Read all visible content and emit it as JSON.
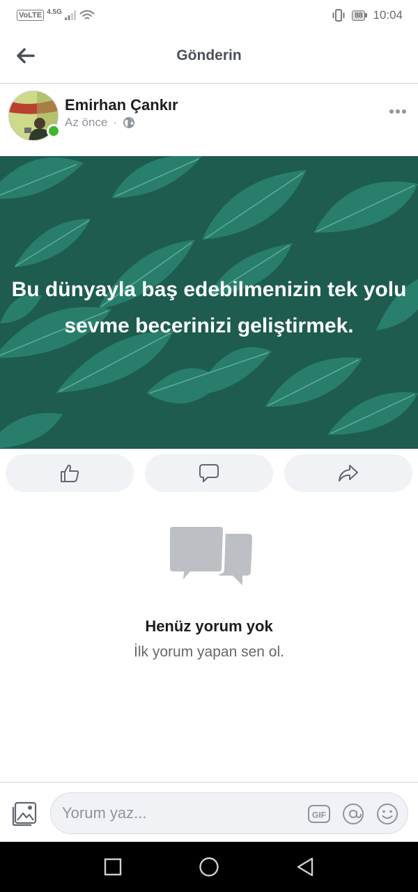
{
  "status_bar": {
    "network_label": "VoLTE",
    "network_type": "4.5G",
    "battery": "88",
    "time": "10:04"
  },
  "header": {
    "title": "Gönderin"
  },
  "post": {
    "author": "Emirhan Çankır",
    "time": "Az önce",
    "separator": "·",
    "visibility_icon": "globe-icon",
    "text": "Bu dünyayla baş edebilmenizin tek yolu sevme becerinizi geliştirmek.",
    "background_color": "#1d5c4f"
  },
  "actions": [
    {
      "name": "like",
      "icon": "thumbs-up-icon"
    },
    {
      "name": "comment",
      "icon": "comment-icon"
    },
    {
      "name": "share",
      "icon": "share-icon"
    }
  ],
  "comments": {
    "empty_title": "Henüz yorum yok",
    "empty_subtitle": "İlk yorum yapan sen ol."
  },
  "composer": {
    "placeholder": "Yorum yaz...",
    "gif_label": "GIF"
  },
  "colors": {
    "accent_green": "#42b72a",
    "icon_gray": "#606770",
    "placeholder_gray": "#8d949e"
  }
}
